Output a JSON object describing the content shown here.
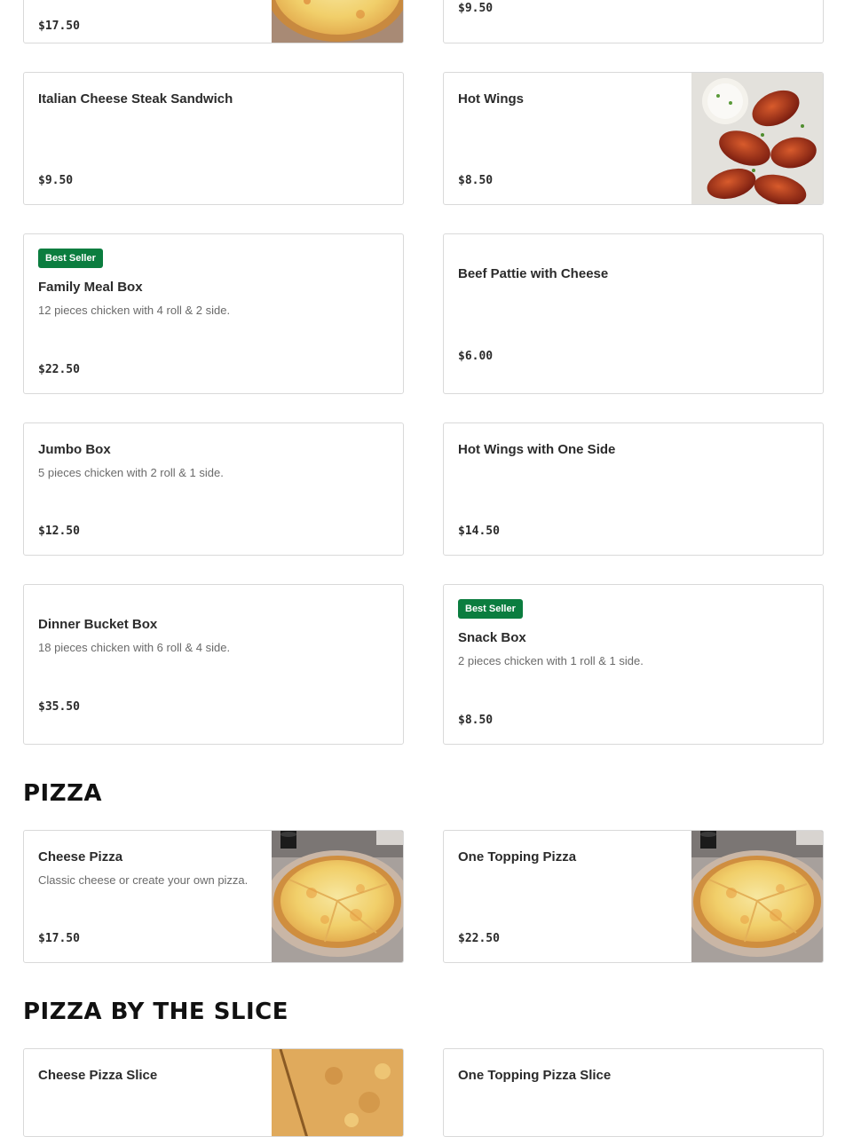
{
  "top_row": {
    "left_price": "$17.50",
    "right_price": "$9.50"
  },
  "items": [
    {
      "name": "Italian Cheese Steak Sandwich",
      "price": "$9.50"
    },
    {
      "name": "Hot Wings",
      "price": "$8.50",
      "image": "hot-wings-photo"
    },
    {
      "badge": "Best Seller",
      "name": "Family Meal Box",
      "description": "12 pieces chicken with 4 roll & 2 side.",
      "price": "$22.50"
    },
    {
      "name": "Beef Pattie with Cheese",
      "price": "$6.00"
    },
    {
      "name": "Jumbo Box",
      "description": "5 pieces chicken with 2 roll & 1 side.",
      "price": "$12.50"
    },
    {
      "name": "Hot Wings with One Side",
      "price": "$14.50"
    },
    {
      "name": "Dinner Bucket Box",
      "description": "18 pieces chicken with 6 roll & 4 side.",
      "price": "$35.50"
    },
    {
      "badge": "Best Seller",
      "name": "Snack Box",
      "description": "2 pieces chicken with 1 roll & 1 side.",
      "price": "$8.50"
    }
  ],
  "sections": {
    "pizza": {
      "title": "PIZZA",
      "items": [
        {
          "name": "Cheese Pizza",
          "description": "Classic cheese or create your own pizza.",
          "price": "$17.50",
          "image": "cheese-pizza-photo"
        },
        {
          "name": "One Topping Pizza",
          "price": "$22.50",
          "image": "cheese-pizza-photo"
        }
      ]
    },
    "slice": {
      "title": "PIZZA BY THE SLICE",
      "items": [
        {
          "name": "Cheese Pizza Slice",
          "image": "pizza-slice-photo"
        },
        {
          "name": "One Topping Pizza Slice"
        }
      ]
    }
  },
  "colors": {
    "badge_bg": "#0b7d3f",
    "border": "#d9d9d9",
    "text": "#2b2b2b",
    "muted": "#6a6a6a"
  }
}
